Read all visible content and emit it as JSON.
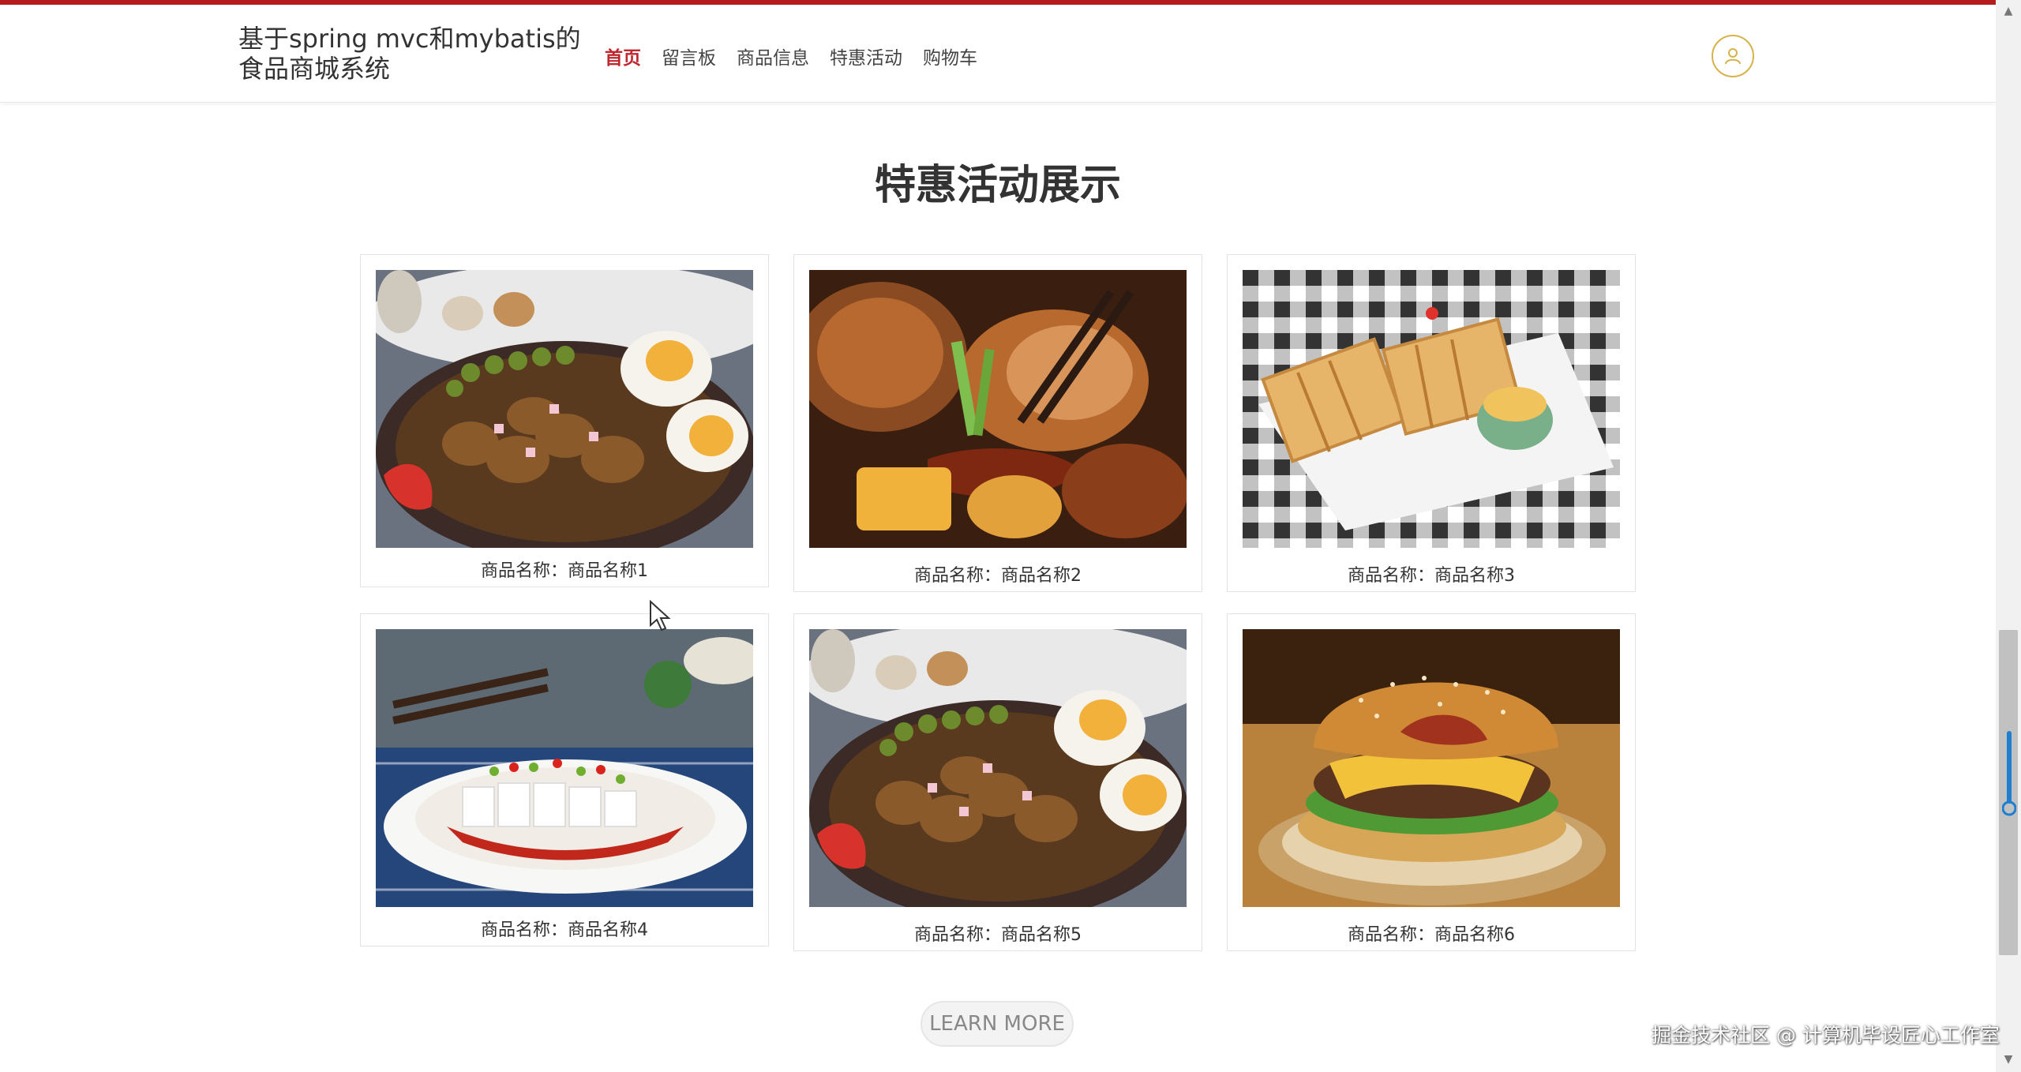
{
  "header": {
    "site_title": "基于spring mvc和mybatis的食品商城系统",
    "nav": [
      {
        "label": "首页",
        "active": true
      },
      {
        "label": "留言板",
        "active": false
      },
      {
        "label": "商品信息",
        "active": false
      },
      {
        "label": "特惠活动",
        "active": false
      },
      {
        "label": "购物车",
        "active": false
      }
    ],
    "user_icon": "user-icon"
  },
  "main": {
    "section_title": "特惠活动展示",
    "products": [
      {
        "caption": "商品名称：商品名称1",
        "image": "rice-bowl-with-egg"
      },
      {
        "caption": "商品名称：商品名称2",
        "image": "braised-chicken"
      },
      {
        "caption": "商品名称：商品名称3",
        "image": "waffles"
      },
      {
        "caption": "商品名称：商品名称4",
        "image": "chili-jelly-noodles"
      },
      {
        "caption": "商品名称：商品名称5",
        "image": "rice-bowl-with-egg"
      },
      {
        "caption": "商品名称：商品名称6",
        "image": "cheeseburger"
      }
    ],
    "learn_more_label": "LEARN MORE"
  },
  "watermark": "掘金技术社区 @ 计算机毕设匠心工作室",
  "colors": {
    "accent": "#c0262d",
    "stripe": "#b71c1c",
    "user_ring": "#d7b24a"
  }
}
